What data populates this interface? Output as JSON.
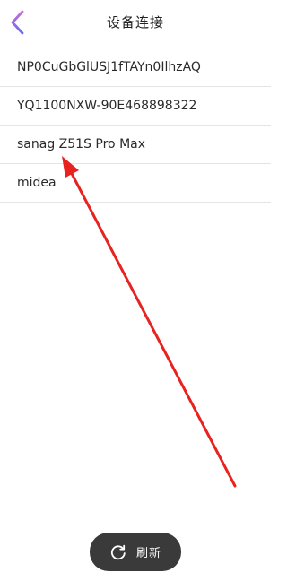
{
  "header": {
    "title": "设备连接",
    "back_icon": "chevron-left-icon",
    "back_icon_gradient": [
      "#c86bd6",
      "#6a6cf0"
    ]
  },
  "devices": [
    {
      "name": "NP0CuGbGlUSJ1fTAYn0IlhzAQ"
    },
    {
      "name": "YQ1100NXW-90E468898322"
    },
    {
      "name": "sanag Z51S Pro Max"
    },
    {
      "name": "midea"
    }
  ],
  "annotation": {
    "type": "arrow",
    "color": "#e8231f"
  },
  "refresh_button": {
    "label": "刷新",
    "icon": "refresh-icon",
    "background": "#3a3a3a"
  }
}
